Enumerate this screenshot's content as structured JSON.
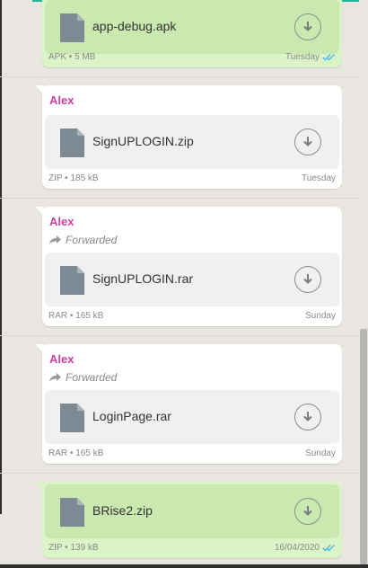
{
  "messages": [
    {
      "direction": "out",
      "sender": "",
      "forwarded": false,
      "file_name": "app-debug.apk",
      "file_type": "APK",
      "file_size": "5 MB",
      "time": "Tuesday",
      "read_receipt": "double-check-icon"
    },
    {
      "direction": "in",
      "sender": "Alex",
      "forwarded": false,
      "file_name": "SignUPLOGIN.zip",
      "file_type": "ZIP",
      "file_size": "185 kB",
      "time": "Tuesday"
    },
    {
      "direction": "in",
      "sender": "Alex",
      "forwarded": true,
      "forwarded_label": "Forwarded",
      "file_name": "SignUPLOGIN.rar",
      "file_type": "RAR",
      "file_size": "165 kB",
      "time": "Sunday"
    },
    {
      "direction": "in",
      "sender": "Alex",
      "forwarded": true,
      "forwarded_label": "Forwarded",
      "file_name": "LoginPage.rar",
      "file_type": "RAR",
      "file_size": "165 kB",
      "time": "Sunday"
    },
    {
      "direction": "out",
      "sender": "",
      "forwarded": false,
      "file_name": "BRise2.zip",
      "file_type": "ZIP",
      "file_size": "139 kB",
      "time": "16/04/2020",
      "read_receipt": "double-check-icon"
    }
  ],
  "meta_separator": "•",
  "icons": {
    "file": "document-icon",
    "download": "download-icon",
    "forward": "forward-arrow-icon",
    "read": "double-check-icon"
  },
  "colors": {
    "outgoing_bubble": "#daf4c8",
    "incoming_bubble": "#ffffff",
    "sender_name": "#d23fa6",
    "read_ticks": "#4fb6ec"
  }
}
